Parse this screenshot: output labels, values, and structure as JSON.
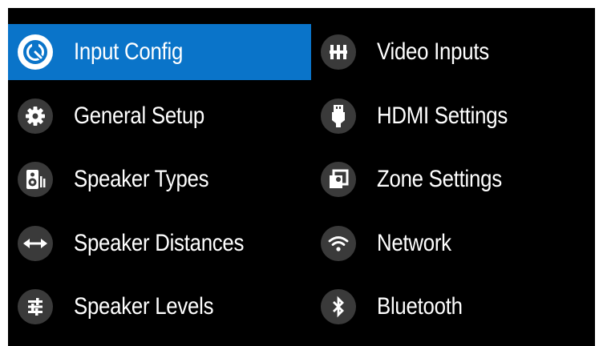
{
  "colors": {
    "background": "#000000",
    "selected_bg": "#0a74c9",
    "icon_circle": "#3a3a3a",
    "text": "#ffffff"
  },
  "menu": {
    "left": [
      {
        "label": "Input Config",
        "icon": "wrench-icon",
        "selected": true
      },
      {
        "label": "General Setup",
        "icon": "gear-icon",
        "selected": false
      },
      {
        "label": "Speaker Types",
        "icon": "speaker-icon",
        "selected": false
      },
      {
        "label": "Speaker Distances",
        "icon": "double-arrow-icon",
        "selected": false
      },
      {
        "label": "Speaker Levels",
        "icon": "sliders-icon",
        "selected": false
      }
    ],
    "right": [
      {
        "label": "Video Inputs",
        "icon": "video-input-connector-icon",
        "selected": false
      },
      {
        "label": "HDMI Settings",
        "icon": "hdmi-plug-icon",
        "selected": false
      },
      {
        "label": "Zone Settings",
        "icon": "zone-icon",
        "selected": false
      },
      {
        "label": "Network",
        "icon": "wifi-icon",
        "selected": false
      },
      {
        "label": "Bluetooth",
        "icon": "bluetooth-icon",
        "selected": false
      }
    ]
  }
}
